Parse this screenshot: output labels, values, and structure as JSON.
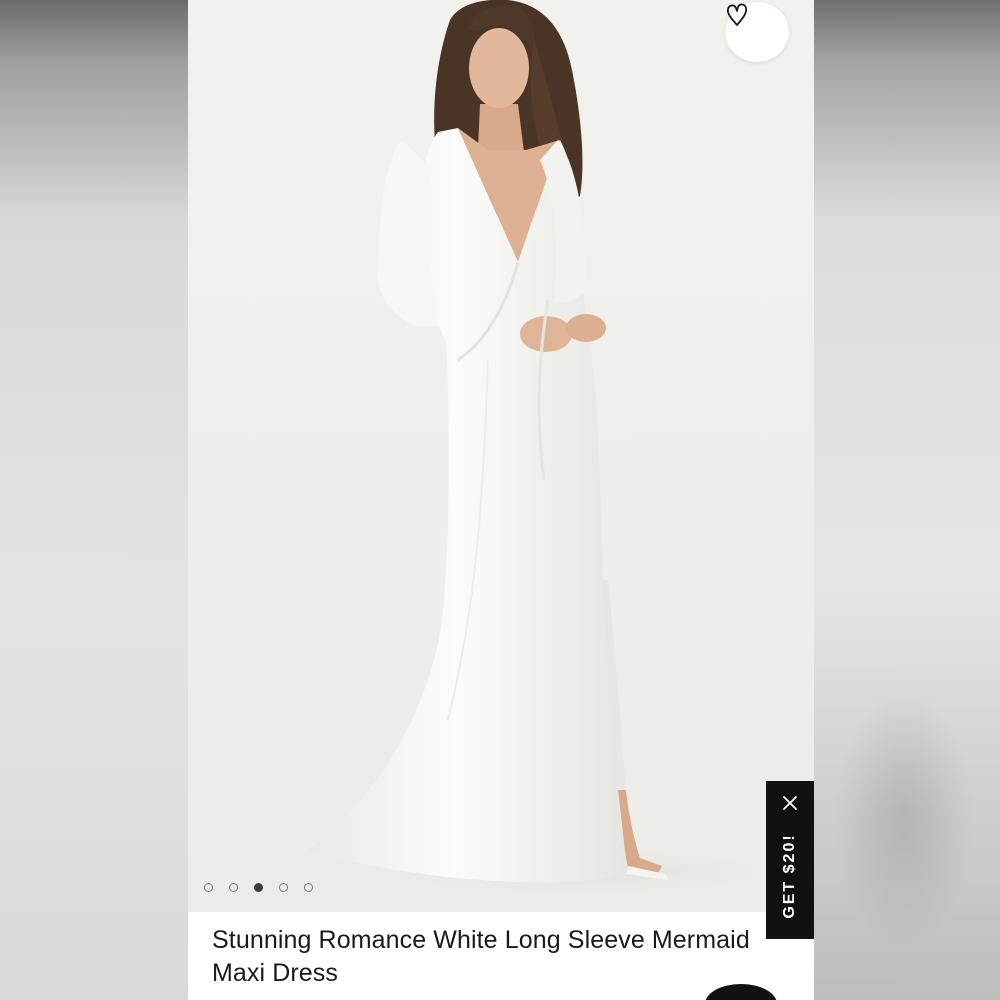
{
  "product": {
    "title": "Stunning Romance White Long Sleeve Mermaid Maxi Dress",
    "image_subject": "model-in-white-long-sleeve-maxi-dress"
  },
  "gallery": {
    "total_images": 5,
    "active_index": 3
  },
  "favorite": {
    "icon": "heart-outline-icon"
  },
  "promo": {
    "label": "GET $20!",
    "close_icon": "close-icon"
  },
  "colors": {
    "background_photo": "#efeeea",
    "dress": "#f8f8f6",
    "promo_bg": "#111111",
    "title_text": "#1a1a1a"
  }
}
